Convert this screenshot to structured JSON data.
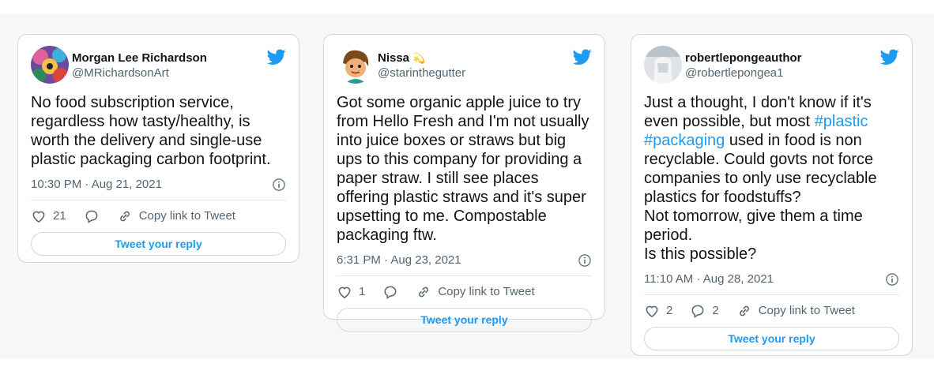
{
  "colors": {
    "twitter_blue": "#1d9bf0",
    "hashtag": "#1d9bf0",
    "text": "#0f1419",
    "muted": "#536471"
  },
  "tweets": [
    {
      "name": "Morgan Lee Richardson",
      "handle": "@MRichardsonArt",
      "text": "No food subscription service, regardless how tasty/healthy, is worth the delivery and single-use plastic packaging carbon footprint.",
      "timestamp": "10:30 PM · Aug 21, 2021",
      "likes": "21",
      "copy_link": "Copy link to Tweet",
      "reply": "Tweet your reply"
    },
    {
      "name": "Nissa",
      "name_emoji": "💫",
      "handle": "@starinthegutter",
      "text": "Got some organic apple juice to try from Hello Fresh and I'm not usually into juice boxes or straws but big ups to this company for providing a paper straw. I still see places offering plastic straws and it's super upsetting to me. Compostable packaging ftw.",
      "timestamp": "6:31 PM · Aug 23, 2021",
      "likes": "1",
      "copy_link": "Copy link to Tweet",
      "reply": "Tweet your reply"
    },
    {
      "name": "robertlepongeauthor",
      "handle": "@robertlepongea1",
      "text_before": "Just a thought, I don't know if it's even possible, but most ",
      "hashtag1": "#plastic",
      "text_space": " ",
      "hashtag2": "#packaging",
      "text_after": " used in food is non recyclable. Could govts not force companies to only use recyclable plastics for foodstuffs?\nNot tomorrow, give them a time period.\nIs this possible?",
      "timestamp": "11:10 AM · Aug 28, 2021",
      "likes": "2",
      "replies": "2",
      "copy_link": "Copy link to Tweet",
      "reply": "Tweet your reply"
    }
  ]
}
